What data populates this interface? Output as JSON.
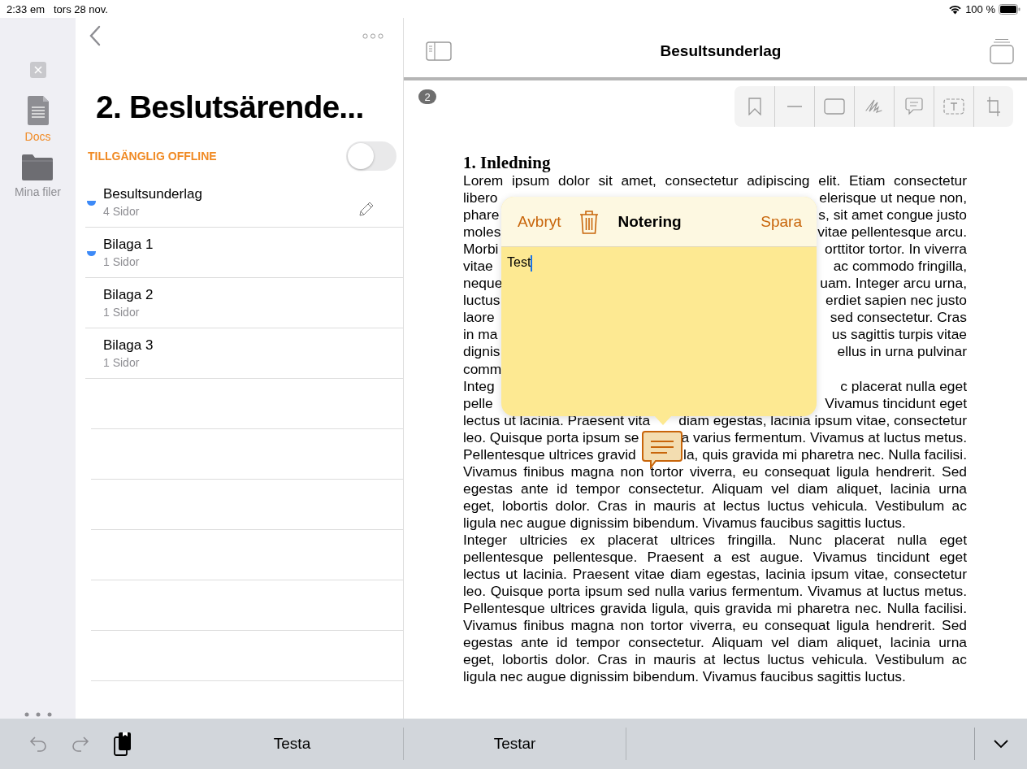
{
  "status_bar": {
    "time": "2:33 em",
    "date": "tors 28 nov.",
    "battery": "100 %"
  },
  "rail": {
    "items": [
      {
        "label": "Docs",
        "kind": "document",
        "selected": true
      },
      {
        "label": "Mina filer",
        "kind": "folder",
        "selected": false
      }
    ]
  },
  "files_panel": {
    "title": "2. Beslutsärende...",
    "offline": {
      "label": "TILLGÄNGLIG OFFLINE",
      "on": false
    },
    "files": [
      {
        "name": "Besultsunderlag",
        "pages": "4 Sidor",
        "unread": true,
        "selected": true
      },
      {
        "name": "Bilaga 1",
        "pages": "1 Sidor",
        "unread": true,
        "selected": false
      },
      {
        "name": "Bilaga 2",
        "pages": "1 Sidor",
        "unread": false,
        "selected": false
      },
      {
        "name": "Bilaga 3",
        "pages": "1 Sidor",
        "unread": false,
        "selected": false
      }
    ]
  },
  "document": {
    "title": "Besultsunderlag",
    "page_badge": "2",
    "heading": "1. Inledning",
    "paragraphs": [
      {
        "lines": [
          {
            "text": "Lorem ipsum dolor sit amet, consectetur adipiscing elit. Etiam consectetur"
          },
          {
            "left": "libero",
            "right": "elerisque ut neque non,"
          },
          {
            "left": "phare",
            "right": "s, sit amet congue justo"
          },
          {
            "left": "moles",
            "right": "vitae pellentesque arcu."
          },
          {
            "left": "Morbi",
            "right": "orttitor tortor. In viverra"
          },
          {
            "left": "vitae",
            "right": "ac commodo fringilla,"
          },
          {
            "left": "neque",
            "right": "uam. Integer arcu urna,"
          },
          {
            "left": "luctus",
            "right": "erdiet sapien nec justo"
          },
          {
            "left": "laore",
            "right": "sed consectetur. Cras"
          },
          {
            "left": "in ma",
            "right": "us sagittis turpis vitae"
          },
          {
            "left": "dignis",
            "right": "ellus in urna pulvinar"
          },
          {
            "left": "comm"
          }
        ]
      },
      {
        "lines": [
          {
            "left": "Integ",
            "right": "c placerat nulla eget"
          },
          {
            "left": "pelle",
            "right": "Vivamus tincidunt eget"
          },
          {
            "left": "lectus ut lacinia. Praesent vita",
            "right": "diam egestas, lacinia ipsum vitae, consectetur"
          },
          {
            "left": "leo. Quisque porta ipsum se",
            "right": "a varius fermentum. Vivamus at luctus metus."
          },
          {
            "left": "Pellentesque ultrices gravid",
            "right": "la, quis gravida mi pharetra nec. Nulla facilisi."
          },
          {
            "text": "Vivamus finibus magna non tortor viverra, eu consequat ligula hendrerit. Sed"
          },
          {
            "text": "egestas ante id tempor consectetur. Aliquam vel diam aliquet, lacinia urna"
          },
          {
            "text": "eget, lobortis dolor. Cras in mauris at lectus luctus vehicula. Vestibulum ac"
          },
          {
            "text": "ligula nec augue dignissim bibendum. Vivamus faucibus sagittis luctus."
          }
        ]
      },
      {
        "lines": [
          {
            "text": "Integer ultricies ex placerat ultrices fringilla. Nunc placerat nulla eget"
          },
          {
            "text": "pellentesque pellentesque. Praesent a est augue. Vivamus tincidunt eget"
          },
          {
            "text": "lectus ut lacinia. Praesent vitae diam egestas, lacinia ipsum vitae, consectetur"
          },
          {
            "text": "leo. Quisque porta ipsum sed nulla varius fermentum. Vivamus at luctus metus."
          },
          {
            "text": "Pellentesque ultrices gravida ligula, quis gravida mi pharetra nec. Nulla facilisi."
          },
          {
            "text": "Vivamus finibus magna non tortor viverra, eu consequat ligula hendrerit. Sed"
          },
          {
            "text": "egestas ante id tempor consectetur. Aliquam vel diam aliquet, lacinia urna"
          },
          {
            "text": "eget, lobortis dolor. Cras in mauris at lectus luctus vehicula. Vestibulum ac"
          },
          {
            "text": "ligula nec augue dignissim bibendum. Vivamus faucibus sagittis luctus."
          }
        ]
      }
    ]
  },
  "note": {
    "cancel": "Avbryt",
    "title": "Notering",
    "save": "Spara",
    "value": "Test"
  },
  "keyboard_bar": {
    "suggestions": [
      "Testa",
      "Testar"
    ]
  }
}
